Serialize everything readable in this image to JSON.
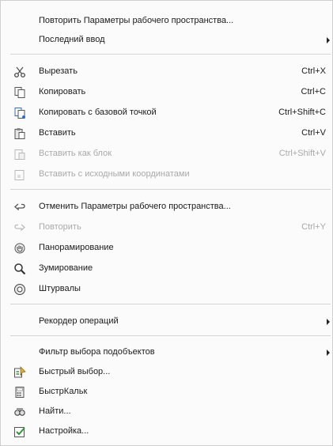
{
  "menu": {
    "items": [
      {
        "label": "Повторить Параметры рабочего пространства..."
      },
      {
        "label": "Последний ввод"
      },
      {
        "label": "Вырезать",
        "shortcut": "Ctrl+X"
      },
      {
        "label": "Копировать",
        "shortcut": "Ctrl+C"
      },
      {
        "label": "Копировать с базовой точкой",
        "shortcut": "Ctrl+Shift+C"
      },
      {
        "label": "Вставить",
        "shortcut": "Ctrl+V"
      },
      {
        "label": "Вставить как блок",
        "shortcut": "Ctrl+Shift+V"
      },
      {
        "label": "Вставить с исходными координатами"
      },
      {
        "label": "Отменить Параметры рабочего пространства..."
      },
      {
        "label": "Повторить",
        "shortcut": "Ctrl+Y"
      },
      {
        "label": "Панорамирование"
      },
      {
        "label": "Зумирование"
      },
      {
        "label": "Штурвалы"
      },
      {
        "label": "Рекордер операций"
      },
      {
        "label": "Фильтр выбора подобъектов"
      },
      {
        "label": "Быстрый выбор..."
      },
      {
        "label": "БыстрКальк"
      },
      {
        "label": "Найти..."
      },
      {
        "label": "Настройка..."
      }
    ]
  },
  "colors": {
    "disabled_text": "#a9a9a9",
    "separator": "#d6d6d6",
    "background": "#fbfbfb"
  }
}
